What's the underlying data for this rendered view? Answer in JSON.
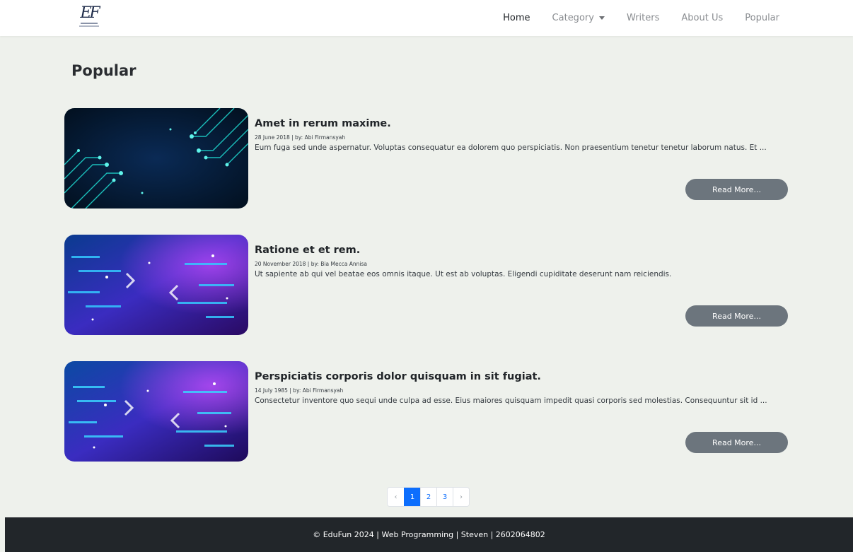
{
  "nav": {
    "logo_text": "EF",
    "links": [
      {
        "label": "Home",
        "active": true
      },
      {
        "label": "Category",
        "dropdown": true
      },
      {
        "label": "Writers"
      },
      {
        "label": "About Us"
      },
      {
        "label": "Popular"
      }
    ]
  },
  "page": {
    "title": "Popular"
  },
  "posts": [
    {
      "title": "Amet in rerum maxime.",
      "meta": "28 June 2018 | by: Abi Firmansyah",
      "excerpt": "Eum fuga sed unde aspernatur. Voluptas consequatur ea dolorem quo perspiciatis. Non praesentium tenetur tenetur laborum natus. Et ...",
      "button": "Read More..."
    },
    {
      "title": "Ratione et et rem.",
      "meta": "20 November 2018 | by: Bia Mecca Annisa",
      "excerpt": "Ut sapiente ab qui vel beatae eos omnis itaque. Ut est ab voluptas. Eligendi cupiditate deserunt nam reiciendis.",
      "button": "Read More..."
    },
    {
      "title": "Perspiciatis corporis dolor quisquam in sit fugiat.",
      "meta": "14 July 1985 | by: Abi Firmansyah",
      "excerpt": "Consectetur inventore quo sequi unde culpa ad esse. Eius maiores quisquam impedit quasi corporis sed molestias. Consequuntur sit id ...",
      "button": "Read More..."
    }
  ],
  "pagination": {
    "prev": "‹",
    "pages": [
      "1",
      "2",
      "3"
    ],
    "current": "1",
    "next": "›"
  },
  "footer": {
    "text": "© EduFun 2024 | Web Programming | Steven | 2602064802"
  },
  "colors": {
    "accent": "#0d6efd",
    "button": "#6c757d",
    "footer_bg": "#22262a",
    "page_bg": "#eef1ec"
  }
}
